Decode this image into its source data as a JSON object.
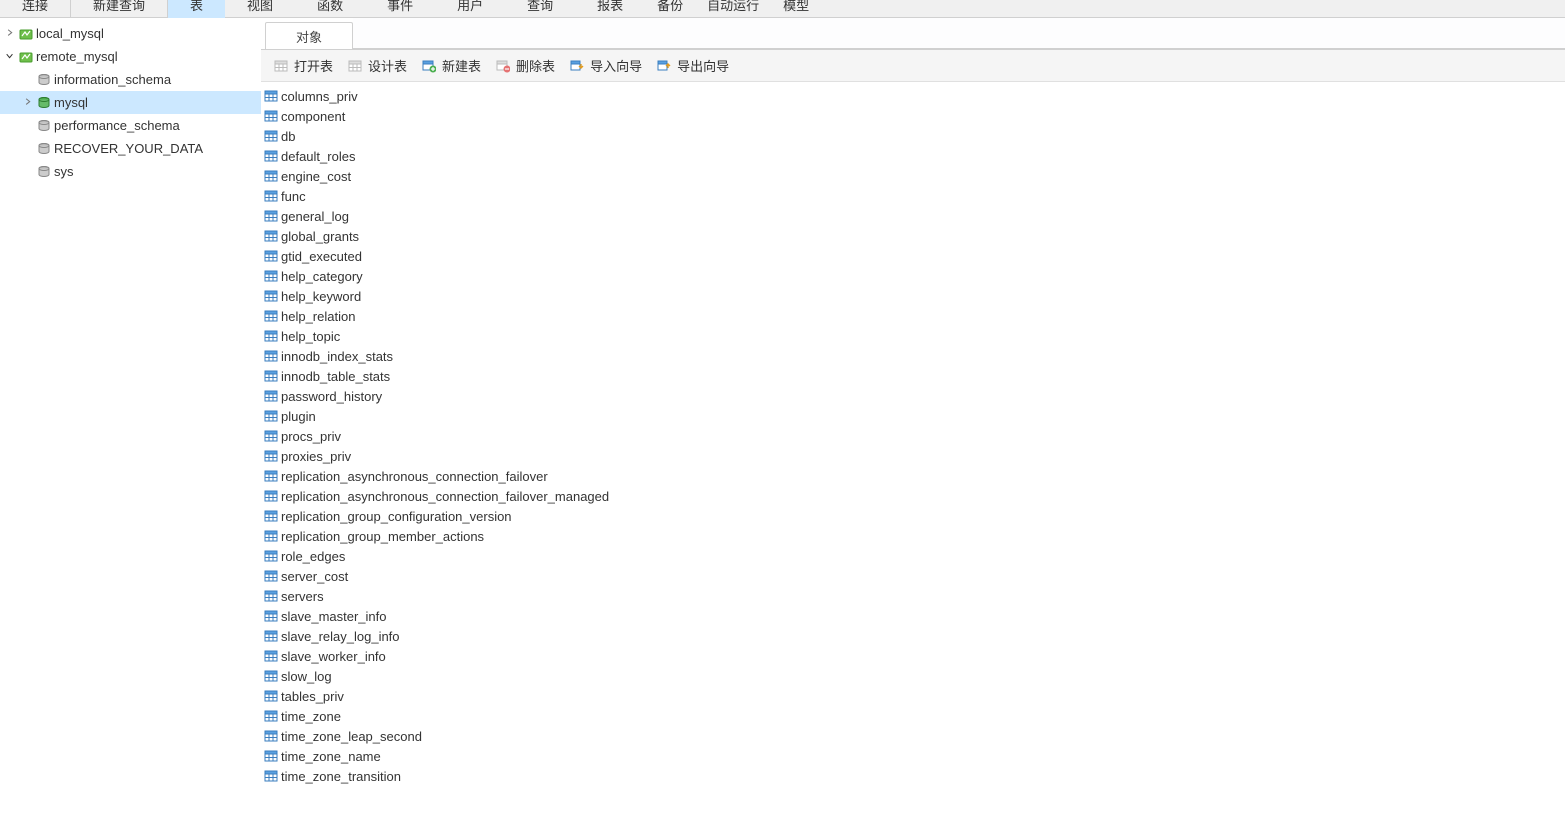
{
  "top_menu": {
    "items": [
      "连接",
      "新建查询",
      "表",
      "视图",
      "函数",
      "事件",
      "用户",
      "查询",
      "报表",
      "备份",
      "自动运行",
      "模型"
    ],
    "active_index": 2
  },
  "tree": [
    {
      "type": "conn",
      "label": "local_mysql",
      "expandable": true,
      "expanded": false,
      "indent": 0,
      "selected": false
    },
    {
      "type": "conn",
      "label": "remote_mysql",
      "expandable": true,
      "expanded": true,
      "indent": 0,
      "selected": false
    },
    {
      "type": "db",
      "label": "information_schema",
      "expandable": false,
      "expanded": false,
      "indent": 1,
      "selected": false,
      "active": false
    },
    {
      "type": "db",
      "label": "mysql",
      "expandable": true,
      "expanded": false,
      "indent": 1,
      "selected": true,
      "active": true
    },
    {
      "type": "db",
      "label": "performance_schema",
      "expandable": false,
      "expanded": false,
      "indent": 1,
      "selected": false,
      "active": false
    },
    {
      "type": "db",
      "label": "RECOVER_YOUR_DATA",
      "expandable": false,
      "expanded": false,
      "indent": 1,
      "selected": false,
      "active": false
    },
    {
      "type": "db",
      "label": "sys",
      "expandable": false,
      "expanded": false,
      "indent": 1,
      "selected": false,
      "active": false
    }
  ],
  "tabs": [
    {
      "label": "对象",
      "active": true
    }
  ],
  "toolbar": [
    {
      "label": "打开表",
      "icon": "table",
      "enabled": false
    },
    {
      "label": "设计表",
      "icon": "design",
      "enabled": false
    },
    {
      "label": "新建表",
      "icon": "new-table",
      "enabled": true
    },
    {
      "label": "删除表",
      "icon": "delete",
      "enabled": false
    },
    {
      "label": "导入向导",
      "icon": "import",
      "enabled": true
    },
    {
      "label": "导出向导",
      "icon": "export",
      "enabled": true
    }
  ],
  "tables": [
    "columns_priv",
    "component",
    "db",
    "default_roles",
    "engine_cost",
    "func",
    "general_log",
    "global_grants",
    "gtid_executed",
    "help_category",
    "help_keyword",
    "help_relation",
    "help_topic",
    "innodb_index_stats",
    "innodb_table_stats",
    "password_history",
    "plugin",
    "procs_priv",
    "proxies_priv",
    "replication_asynchronous_connection_failover",
    "replication_asynchronous_connection_failover_managed",
    "replication_group_configuration_version",
    "replication_group_member_actions",
    "role_edges",
    "server_cost",
    "servers",
    "slave_master_info",
    "slave_relay_log_info",
    "slave_worker_info",
    "slow_log",
    "tables_priv",
    "time_zone",
    "time_zone_leap_second",
    "time_zone_name",
    "time_zone_transition"
  ]
}
